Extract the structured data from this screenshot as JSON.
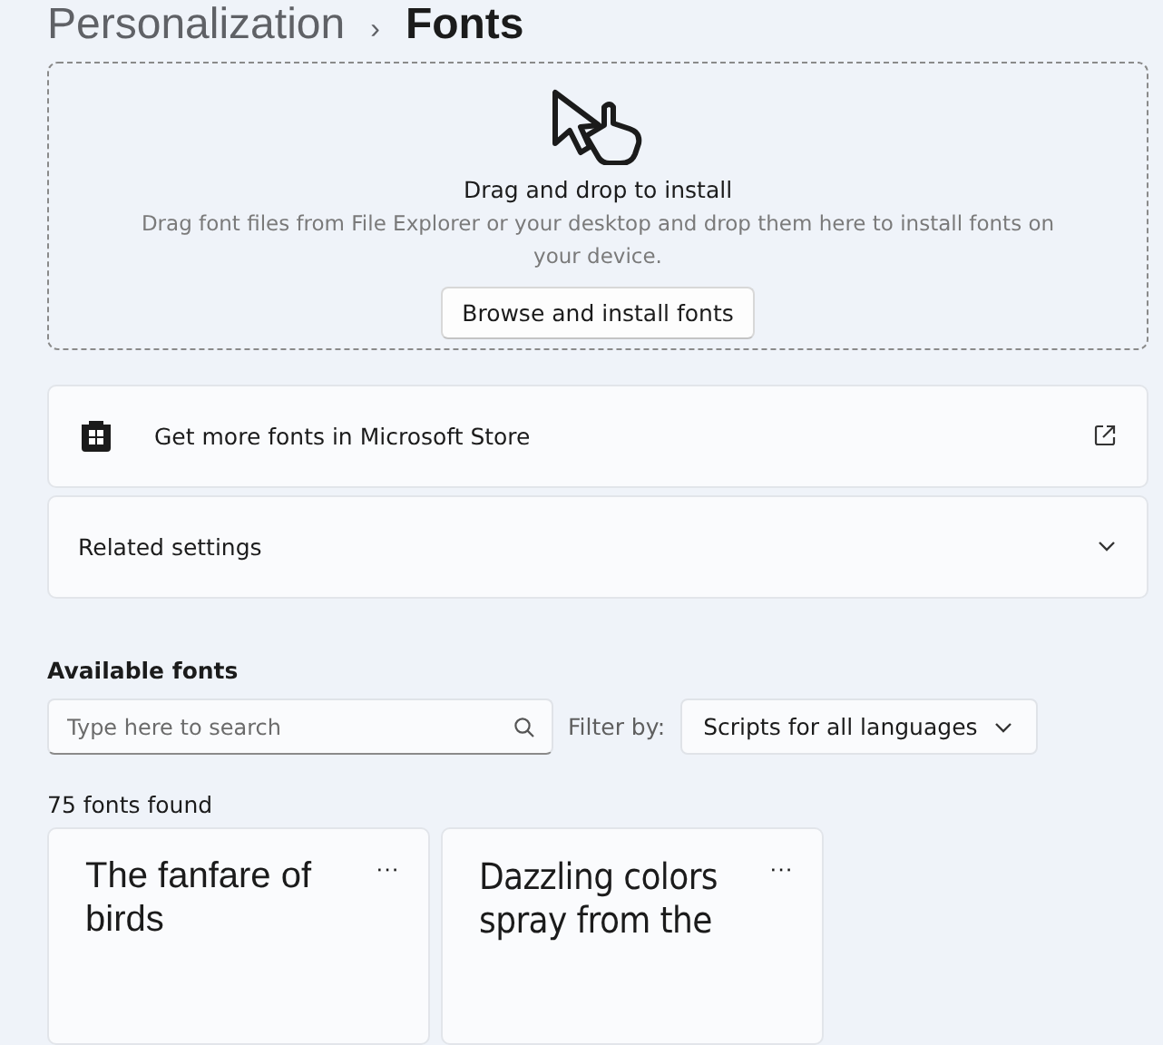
{
  "breadcrumb": {
    "parent": "Personalization",
    "separator": "›",
    "current": "Fonts"
  },
  "drop_zone": {
    "title": "Drag and drop to install",
    "description": "Drag font files from File Explorer or your desktop and drop them here to install fonts on your device.",
    "button": "Browse and install fonts"
  },
  "store_link": {
    "label": "Get more fonts in Microsoft Store"
  },
  "related_settings": {
    "label": "Related settings",
    "expanded": false
  },
  "available_fonts": {
    "heading": "Available fonts",
    "search": {
      "placeholder": "Type here to search"
    },
    "filter_label": "Filter by:",
    "filter_value": "Scripts for all languages",
    "count": "75 fonts found",
    "fonts": [
      {
        "preview": "The fanfare of birds",
        "more": "···",
        "kind": "sans"
      },
      {
        "preview": "Dazzling colors spray from the",
        "more": "···",
        "kind": "condensed"
      }
    ]
  }
}
